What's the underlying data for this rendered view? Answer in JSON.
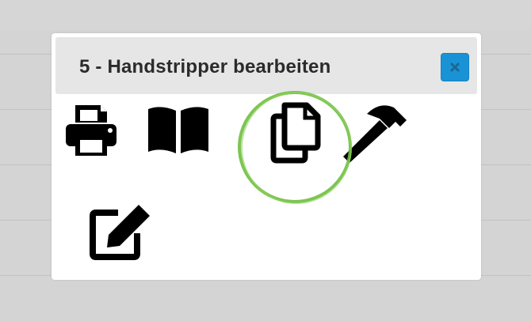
{
  "dialog": {
    "title": "5 - Handstripper bearbeiten",
    "close_icon": "close-icon"
  },
  "tools": [
    {
      "name": "print",
      "icon": "printer-icon"
    },
    {
      "name": "manual",
      "icon": "open-book-icon"
    },
    {
      "name": "copy",
      "icon": "copy-icon",
      "highlighted": true
    },
    {
      "name": "repair",
      "icon": "hammer-icon"
    },
    {
      "name": "edit",
      "icon": "edit-icon"
    }
  ],
  "colors": {
    "close_button": "#1a93d6",
    "highlight_ring": "#6fbf3f",
    "header_bg": "#e6e6e6",
    "icon": "#000000"
  }
}
